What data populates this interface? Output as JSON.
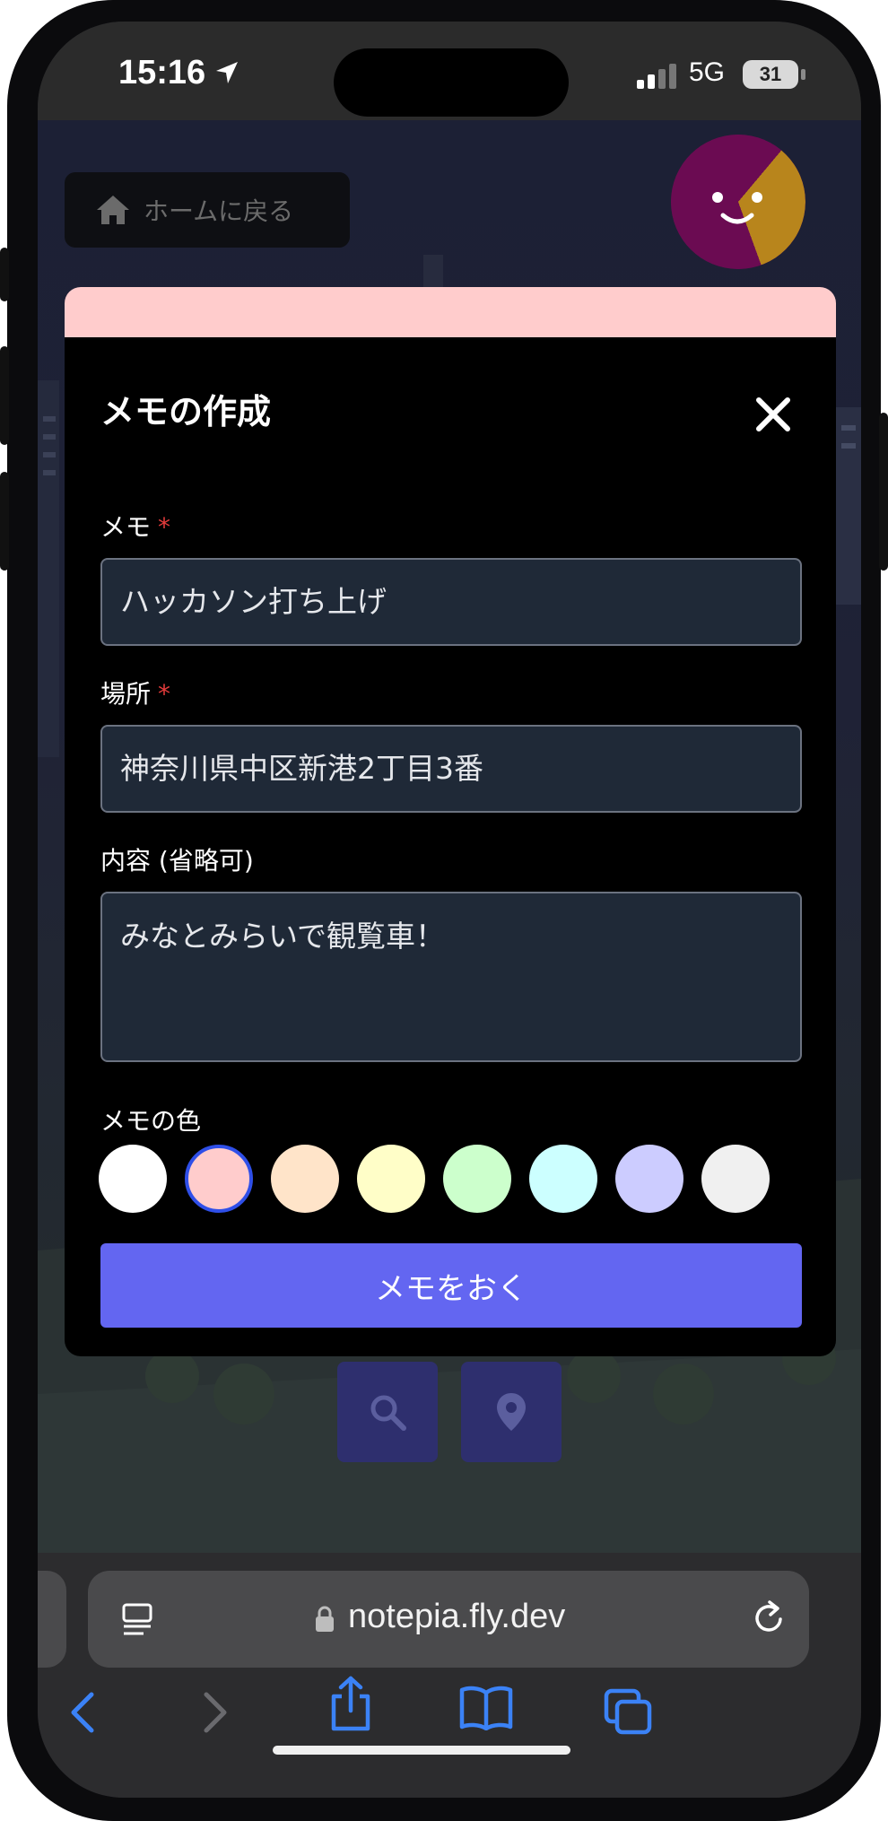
{
  "status_bar": {
    "time": "15:16",
    "network": "5G",
    "battery": "31"
  },
  "background": {
    "home_button_label": "ホームに戻る",
    "avatar_icon": "smiley-face-avatar",
    "tools": [
      {
        "icon": "search-icon"
      },
      {
        "icon": "map-pin-icon"
      }
    ]
  },
  "modal": {
    "title": "メモの作成",
    "close_icon": "close-icon",
    "memo": {
      "label": "メモ",
      "required_mark": "*",
      "value": "ハッカソン打ち上げ"
    },
    "place": {
      "label": "場所",
      "required_mark": "*",
      "value": "神奈川県中区新港2丁目3番"
    },
    "content": {
      "label": "内容 (省略可)",
      "value": "みなとみらいで観覧車！"
    },
    "color": {
      "label": "メモの色",
      "options": [
        "#ffffff",
        "#ffcccc",
        "#ffe4c9",
        "#fffec8",
        "#ccffcc",
        "#ccffff",
        "#ccccff",
        "#f0f0f0"
      ],
      "selected": "#ffcccc"
    },
    "submit_label": "メモをおく",
    "accent_color": "#6366f1"
  },
  "browser": {
    "url": "notepia.fly.dev",
    "icons": [
      "reader-icon",
      "lock-icon",
      "reload-icon",
      "back-icon",
      "forward-icon",
      "share-icon",
      "bookmarks-icon",
      "tabs-icon"
    ]
  }
}
